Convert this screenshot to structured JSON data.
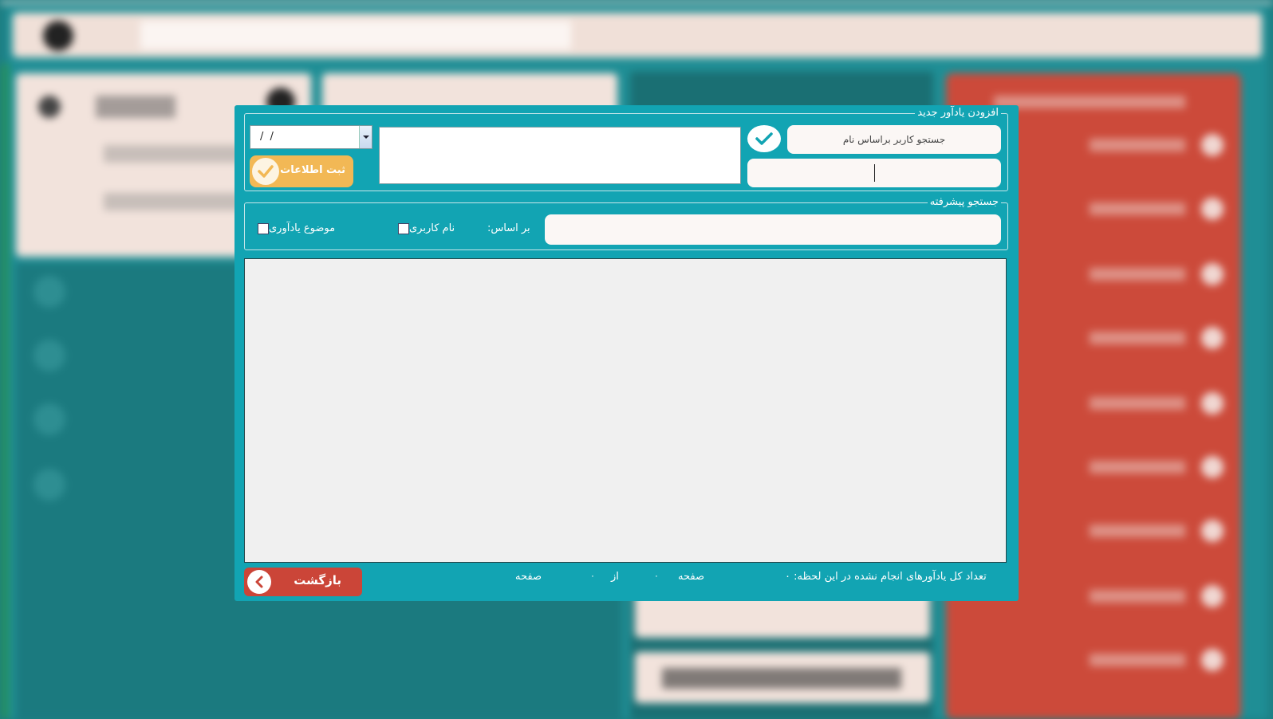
{
  "dialog": {
    "add_group_title": "افزودن یادآور جدید",
    "date_value": "/ /",
    "submit_label": "ثبت اطلاعات",
    "user_search_label": "جستجو کاربر براساس نام",
    "user_input_value": "",
    "note_value": "",
    "advanced_group_title": "جستجو پیشرفته",
    "advanced_input_value": "",
    "basis_label": "بر اساس:",
    "checkbox_username_label": "نام کاربری",
    "checkbox_subject_label": "موضوع یادآوری",
    "back_label": "بازگشت",
    "pagination": {
      "page_word": "صفحه",
      "current_page": "۰",
      "of_word": "از",
      "total_pages": "۰",
      "page_word_end": "صفحه"
    },
    "total_label": "تعداد کل یادآورهای انجام نشده در این لحظه: ۰"
  },
  "colors": {
    "dialog_bg": "#12a4b3",
    "submit_bg": "#f2b855",
    "back_bg": "#cb4538",
    "background_red_panel": "#cc4a3a",
    "background_teal": "#1b7a7f"
  },
  "icons": {
    "submit": "check-icon",
    "confirm_user": "check-icon",
    "back": "chevron-left-icon",
    "date_dropdown": "chevron-down-icon"
  }
}
